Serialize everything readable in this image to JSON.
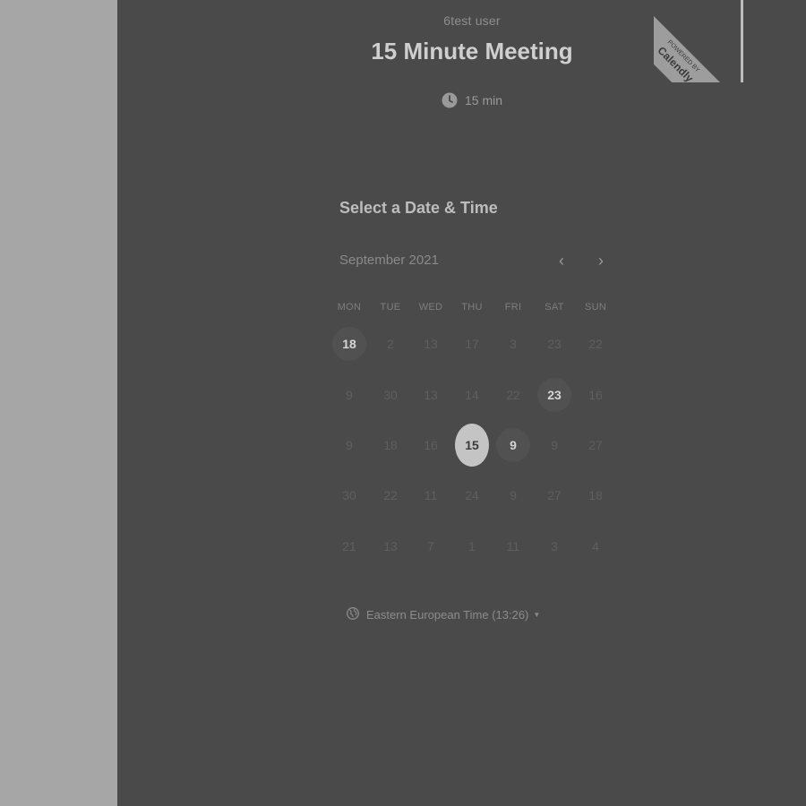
{
  "host": {
    "name": "6test user"
  },
  "event": {
    "title": "15 Minute Meeting",
    "duration": "15 min",
    "duration_icon": "clock-icon"
  },
  "ribbon": {
    "line1": "POWERED BY",
    "brand": "Calendly"
  },
  "calendar": {
    "heading": "Select a Date & Time",
    "month": "September 2021",
    "prev_icon": "‹",
    "next_icon": "›",
    "weekdays": [
      "MON",
      "TUE",
      "WED",
      "THU",
      "FRI",
      "SAT",
      "SUN"
    ],
    "weeks": [
      [
        {
          "label": "18",
          "state": "available"
        },
        {
          "label": "2",
          "state": "disabled"
        },
        {
          "label": "13",
          "state": "disabled"
        },
        {
          "label": "17",
          "state": "disabled"
        },
        {
          "label": "3",
          "state": "disabled"
        },
        {
          "label": "23",
          "state": "disabled"
        },
        {
          "label": "22",
          "state": "disabled"
        }
      ],
      [
        {
          "label": "9",
          "state": "disabled"
        },
        {
          "label": "30",
          "state": "disabled"
        },
        {
          "label": "13",
          "state": "disabled"
        },
        {
          "label": "14",
          "state": "disabled"
        },
        {
          "label": "22",
          "state": "disabled"
        },
        {
          "label": "23",
          "state": "available"
        },
        {
          "label": "16",
          "state": "disabled"
        }
      ],
      [
        {
          "label": "9",
          "state": "disabled"
        },
        {
          "label": "18",
          "state": "disabled"
        },
        {
          "label": "16",
          "state": "disabled"
        },
        {
          "label": "15",
          "state": "selected"
        },
        {
          "label": "9",
          "state": "available"
        },
        {
          "label": "9",
          "state": "disabled"
        },
        {
          "label": "27",
          "state": "disabled"
        }
      ],
      [
        {
          "label": "30",
          "state": "disabled"
        },
        {
          "label": "22",
          "state": "disabled"
        },
        {
          "label": "11",
          "state": "disabled"
        },
        {
          "label": "24",
          "state": "disabled"
        },
        {
          "label": "9",
          "state": "disabled"
        },
        {
          "label": "27",
          "state": "disabled"
        },
        {
          "label": "18",
          "state": "disabled"
        }
      ],
      [
        {
          "label": "21",
          "state": "disabled"
        },
        {
          "label": "13",
          "state": "disabled"
        },
        {
          "label": "7",
          "state": "disabled"
        },
        {
          "label": "1",
          "state": "disabled"
        },
        {
          "label": "11",
          "state": "disabled"
        },
        {
          "label": "3",
          "state": "disabled"
        },
        {
          "label": "4",
          "state": "disabled"
        }
      ]
    ]
  },
  "timezone": {
    "label": "Eastern European Time (13:26)",
    "icon": "globe-icon"
  },
  "colors": {
    "background": "#4a4a4a",
    "sidebar": "#a6a6a6",
    "selected_day": "#c4c4c4"
  }
}
